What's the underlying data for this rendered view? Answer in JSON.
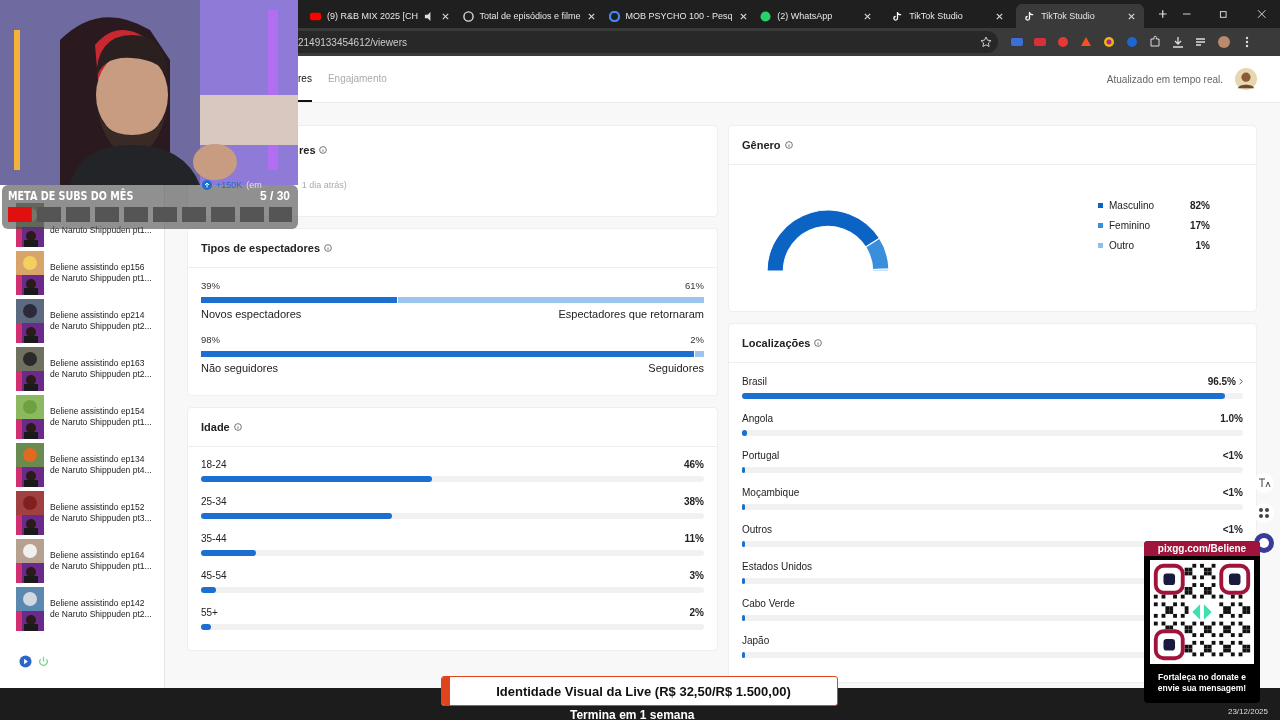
{
  "browser": {
    "tabs": [
      {
        "title": "(9) R&B MIX 2025 [CH",
        "kind": "youtube",
        "audio": true,
        "selected": false
      },
      {
        "title": "Total de episódios e filme",
        "kind": "generic",
        "audio": false,
        "selected": false
      },
      {
        "title": "MOB PSYCHO 100 - Pesq",
        "kind": "google",
        "audio": false,
        "selected": false
      },
      {
        "title": "(2) WhatsApp",
        "kind": "whatsapp",
        "audio": false,
        "selected": false
      },
      {
        "title": "TikTok Studio",
        "kind": "tiktok",
        "audio": false,
        "selected": false
      },
      {
        "title": "TikTok Studio",
        "kind": "tiktok",
        "audio": false,
        "selected": true
      }
    ],
    "address": "2149133454612/viewers"
  },
  "header": {
    "tabs": [
      {
        "label": "res",
        "selected": true
      },
      {
        "label": "Engajamento",
        "selected": false
      }
    ],
    "status": "Atualizado em tempo real."
  },
  "sidebar": {
    "items": [
      {
        "line2": "de Naruto Shippuden pt1..."
      },
      {
        "line1": "Beliene assistindo ep156",
        "line2": "de Naruto Shippuden pt1..."
      },
      {
        "line1": "Beliene assistindo ep214",
        "line2": "de Naruto Shippuden pt2..."
      },
      {
        "line1": "Beliene assistindo ep163",
        "line2": "de Naruto Shippuden pt2..."
      },
      {
        "line1": "Beliene assistindo ep154",
        "line2": "de Naruto Shippuden pt1..."
      },
      {
        "line1": "Beliene assistindo ep134",
        "line2": "de Naruto Shippuden pt4..."
      },
      {
        "line1": "Beliene assistindo ep152",
        "line2": "de Naruto Shippuden pt3..."
      },
      {
        "line1": "Beliene assistindo ep164",
        "line2": "de Naruto Shippuden pt1..."
      },
      {
        "line1": "Beliene assistindo ep142",
        "line2": "de Naruto Shippuden pt2..."
      }
    ]
  },
  "overview": {
    "title": "res",
    "growth": "+150K",
    "growth_note": "(em",
    "date_note": "1 dia atrás)"
  },
  "viewer_types": {
    "title": "Tipos de espectadores",
    "rows": [
      {
        "left_value": "39%",
        "right_value": "61%",
        "left_label": "Novos espectadores",
        "right_label": "Espectadores que retornaram",
        "level": 0.39
      },
      {
        "left_value": "98%",
        "right_value": "2%",
        "left_label": "Não seguidores",
        "right_label": "Seguidores",
        "level": 0.98
      }
    ]
  },
  "age": {
    "title": "Idade",
    "rows": [
      {
        "label": "18-24",
        "value": "46%",
        "level": 0.46
      },
      {
        "label": "25-34",
        "value": "38%",
        "level": 0.38
      },
      {
        "label": "35-44",
        "value": "11%",
        "level": 0.11
      },
      {
        "label": "45-54",
        "value": "3%",
        "level": 0.03
      },
      {
        "label": "55+",
        "value": "2%",
        "level": 0.02
      }
    ]
  },
  "gender": {
    "title": "Gênero",
    "chart_data": {
      "type": "donut",
      "categories": [
        "Masculino",
        "Feminino",
        "Outro"
      ],
      "values": [
        82,
        17,
        1
      ]
    },
    "legend": [
      {
        "value": "82%",
        "color": "#0b63c4"
      },
      {
        "value": "17%",
        "color": "#3a8fdc"
      },
      {
        "value": "1%",
        "color": "#8ec0ec"
      }
    ]
  },
  "locations": {
    "title": "Localizações",
    "rows": [
      {
        "label": "Brasil",
        "value": "96.5%",
        "level": 0.965,
        "expandable": true
      },
      {
        "label": "Angola",
        "value": "1.0%",
        "level": 0.01,
        "expandable": false
      },
      {
        "label": "Portugal",
        "value": "<1%",
        "level": 0.006,
        "expandable": false
      },
      {
        "label": "Moçambique",
        "value": "<1%",
        "level": 0.005,
        "expandable": false
      },
      {
        "label": "Outros",
        "value": "<1%",
        "level": 0.005,
        "expandable": false
      },
      {
        "label": "Estados Unidos",
        "level": 0.003,
        "expandable": false
      },
      {
        "label": "Cabo Verde",
        "level": 0.002,
        "expandable": false
      },
      {
        "label": "Japão",
        "level": 0.002,
        "expandable": false
      }
    ]
  },
  "stream_overlay": {
    "goal": {
      "title": "META DE SUBS DO MÊS",
      "count": "5 / 30",
      "level": 0.08
    },
    "donation": {
      "text": "Identidade Visual da Live (R$ 32,50/R$ 1.500,00)",
      "level": 0.02,
      "ends": "Termina em 1 semana"
    },
    "qr": {
      "url": "pixgg.com/Beliene",
      "message": "Fortaleça no donate e envie sua mensagem!"
    }
  },
  "taskbar": {
    "date": "23/12/2025"
  }
}
